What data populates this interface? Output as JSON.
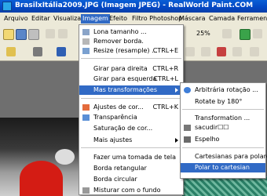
{
  "title": "BrasilxItália2009.JPG (Imagem JPEG) - RealWorld Paint.COM",
  "menubar": [
    "Arquivo",
    "Editar",
    "Visualizar",
    "Imagem",
    "Efeito",
    "Filtro Photoshop",
    "Máscara",
    "Camada",
    "Ferramentas"
  ],
  "toolbar": {
    "zoom": "25%"
  },
  "image_menu": {
    "items": [
      {
        "label": "Lona tamanho ...",
        "shortcut": "",
        "icon": "canvas-size-icon"
      },
      {
        "label": "Remover borda.",
        "shortcut": "",
        "icon": "crop-icon"
      },
      {
        "label": "Resize (resample) ...",
        "shortcut": "CTRL+E",
        "icon": "resize-icon"
      },
      {
        "label": "Girar para direita",
        "shortcut": "CTRL+R"
      },
      {
        "label": "Girar para esquerda",
        "shortcut": "CTRL+L"
      },
      {
        "label": "Mas transformações",
        "shortcut": ""
      },
      {
        "label": "Ajustes de cor...",
        "shortcut": "CTRL+K",
        "icon": "color-adjust-icon"
      },
      {
        "label": "Transparência",
        "shortcut": "",
        "icon": "transparency-icon"
      },
      {
        "label": "Saturação de cor...",
        "shortcut": ""
      },
      {
        "label": "Mais ajustes",
        "shortcut": ""
      },
      {
        "label": "Fazer uma tomada de tela",
        "shortcut": ""
      },
      {
        "label": "Borda retangular",
        "shortcut": ""
      },
      {
        "label": "Borda circular",
        "shortcut": ""
      },
      {
        "label": "Misturar com o fundo",
        "shortcut": "",
        "icon": "blend-icon"
      }
    ]
  },
  "submenu": {
    "items": [
      {
        "label": "Arbitrária rotação ...",
        "icon": "rotate-icon"
      },
      {
        "label": "Rotate by 180°"
      },
      {
        "label": "Transformation ..."
      },
      {
        "label": "sacudir☐☐",
        "icon": "shake-icon"
      },
      {
        "label": "Espelho",
        "icon": "mirror-icon"
      },
      {
        "label": "Cartesianas para polares"
      },
      {
        "label": "Polar to cartesian"
      }
    ]
  }
}
